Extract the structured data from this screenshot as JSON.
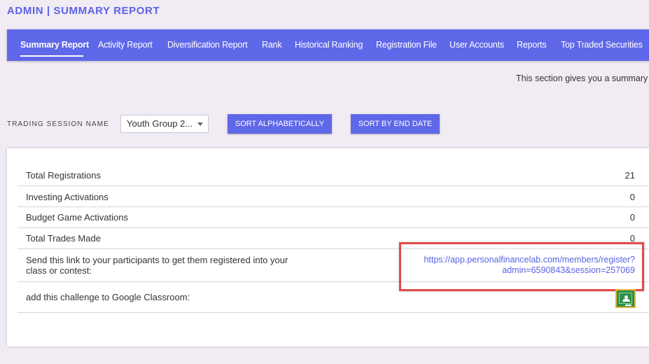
{
  "header": {
    "title": "ADMIN | SUMMARY REPORT"
  },
  "nav": {
    "tabs": [
      {
        "label": "Summary Report",
        "active": true
      },
      {
        "label": "Activity Report"
      },
      {
        "label": "Diversification Report"
      },
      {
        "label": "Rank"
      },
      {
        "label": "Historical Ranking"
      },
      {
        "label": "Registration File"
      },
      {
        "label": "User Accounts"
      },
      {
        "label": "Reports"
      },
      {
        "label": "Top Traded Securities"
      }
    ]
  },
  "intro": {
    "text": "This section gives you a summary o"
  },
  "filters": {
    "session_label": "TRADING SESSION NAME",
    "session_selected": "Youth Group 2...",
    "sort_alpha_label": "SORT ALPHABETICALLY",
    "sort_end_label": "SORT BY END DATE"
  },
  "summary": {
    "rows": [
      {
        "label": "Total Registrations",
        "value": "21"
      },
      {
        "label": "Investing Activations",
        "value": "0"
      },
      {
        "label": "Budget Game Activations",
        "value": "0"
      },
      {
        "label": "Total Trades Made",
        "value": "0"
      }
    ],
    "link_row": {
      "label_line1": "Send this link to your participants to get them registered into your",
      "label_line2": "class or contest:",
      "url_line1": "https://app.personalfinancelab.com/members/register?",
      "url_line2": "admin=6590843&session=257069"
    },
    "classroom_row": {
      "label": "add this challenge to Google Classroom:"
    }
  },
  "colors": {
    "accent": "#5f68e8",
    "title": "#5b63e6",
    "highlight_border": "#e24a4a",
    "classroom_green": "#2a8f48"
  },
  "icons": {
    "select_caret": "chevron-down-icon",
    "classroom": "google-classroom-icon"
  }
}
